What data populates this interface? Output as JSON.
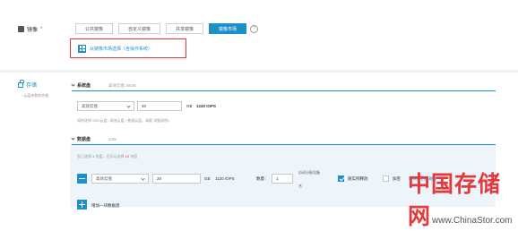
{
  "image": {
    "label": "镜像",
    "required_mark": "*",
    "tabs": [
      {
        "label": "公共镜像",
        "active": false
      },
      {
        "label": "自定义镜像",
        "active": false
      },
      {
        "label": "共享镜像",
        "active": false
      },
      {
        "label": "镜像市场",
        "active": true
      }
    ],
    "help": "?",
    "pick_link": "从镜像市场选择（含操作系统）"
  },
  "storage": {
    "title": "存储",
    "subtitle": "云盘参数和性能",
    "system_disk": {
      "title": "系统盘",
      "meta": "高效云盘  40GB",
      "type": "高效云盘",
      "size": "40",
      "unit": "GB",
      "iops": "1240 IOPS",
      "hint": "如何选择 SSD云盘 / 高效云盘 / 普通云盘，请看 详细说明»"
    },
    "data_disk": {
      "title": "数据盘",
      "count": "1/16",
      "summary_prefix": "您已选择",
      "summary_selected": "1",
      "summary_mid": "块盘，还可以选择",
      "summary_remaining": "15",
      "summary_suffix": "块盘",
      "type": "高效云盘",
      "size": "20",
      "unit": "GB",
      "iops": "1120 IOPS",
      "qty_label": "数量：",
      "qty": "1",
      "device_label_1": "自动分配设备",
      "device_label_2": "名",
      "release_label": "随实例释放",
      "release_checked": true,
      "encrypt_label": "加密",
      "encrypt_checked": false,
      "snapshot_link": "用快照创建磁盘",
      "add_label": "增加一块数据盘"
    }
  },
  "watermark": {
    "cn": "中国存储网",
    "en": "www.ChinaStor.com"
  },
  "colors": {
    "accent": "#1e90c8",
    "highlight_border": "#e4393c",
    "watermark_red": "#e4393c"
  }
}
